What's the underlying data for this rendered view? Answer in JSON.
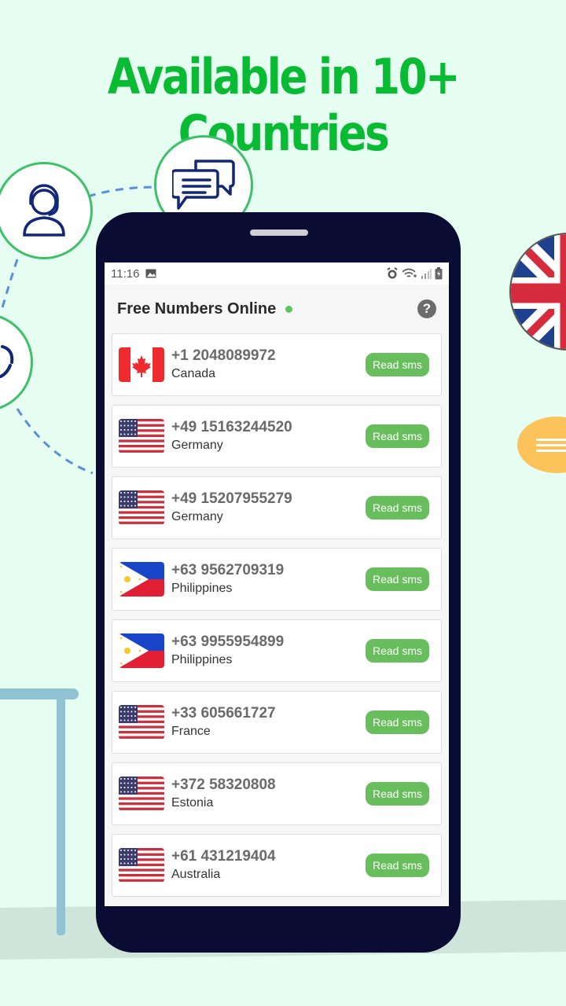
{
  "promo": {
    "headline": "Available in 10+ Countries",
    "colors": {
      "headline": "#08bb32",
      "background": "#e6fdf1",
      "phone_frame": "#0b0c33",
      "button": "#68bd5c"
    }
  },
  "decorations": {
    "icons": [
      "support-agent-icon",
      "chat-bubbles-icon",
      "refresh-icon",
      "uk-flag-icon",
      "message-bubble-icon"
    ]
  },
  "statusbar": {
    "time": "11:16",
    "icons": [
      "image-icon",
      "alarm-icon",
      "wifi-icon",
      "signal-icon",
      "battery-charging-icon"
    ]
  },
  "app": {
    "title": "Free Numbers Online",
    "online_status": "online",
    "help_label": "?"
  },
  "numbers": [
    {
      "number": "+1 2048089972",
      "country": "Canada",
      "flag": "canada",
      "action": "Read sms"
    },
    {
      "number": "+49 15163244520",
      "country": "Germany",
      "flag": "usa",
      "action": "Read sms"
    },
    {
      "number": "+49 15207955279",
      "country": "Germany",
      "flag": "usa",
      "action": "Read sms"
    },
    {
      "number": "+63 9562709319",
      "country": "Philippines",
      "flag": "philippines",
      "action": "Read sms"
    },
    {
      "number": "+63 9955954899",
      "country": "Philippines",
      "flag": "philippines",
      "action": "Read sms"
    },
    {
      "number": "+33 605661727",
      "country": "France",
      "flag": "usa",
      "action": "Read sms"
    },
    {
      "number": "+372 58320808",
      "country": "Estonia",
      "flag": "usa",
      "action": "Read sms"
    },
    {
      "number": "+61 431219404",
      "country": "Australia",
      "flag": "usa",
      "action": "Read sms"
    }
  ]
}
